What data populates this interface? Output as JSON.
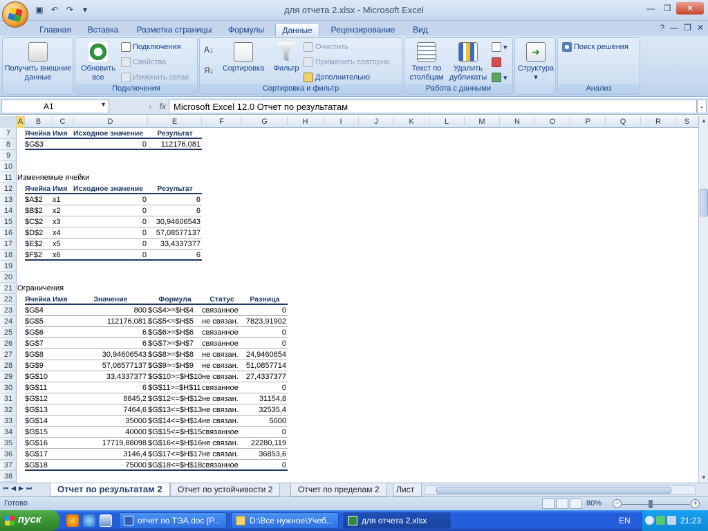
{
  "window": {
    "title": "для отчета 2.xlsx - Microsoft Excel",
    "qat": [
      "save-icon",
      "undo-icon",
      "redo-icon",
      "customize-icon"
    ]
  },
  "tabs": [
    "Главная",
    "Вставка",
    "Разметка страницы",
    "Формулы",
    "Данные",
    "Рецензирование",
    "Вид"
  ],
  "active_tab": "Данные",
  "ribbon": {
    "get_external": "Получить внешние данные",
    "refresh_all": "Обновить все",
    "connections": "Подключения",
    "properties": "Свойства",
    "edit_links": "Изменить связи",
    "group_connections": "Подключения",
    "sort": "Сортировка",
    "filter": "Фильтр",
    "clear": "Очистить",
    "reapply": "Применить повторно",
    "advanced": "Дополнительно",
    "group_sort": "Сортировка и фильтр",
    "text_to_columns": "Текст по столбцам",
    "remove_duplicates": "Удалить дубликаты",
    "group_data_tools": "Работа с данными",
    "outline": "Структура",
    "solver": "Поиск решения",
    "group_analysis": "Анализ"
  },
  "formula_bar": {
    "name_box": "A1",
    "fx": "fx",
    "content": "Microsoft Excel 12.0 Отчет по результатам"
  },
  "columns": [
    "A",
    "B",
    "C",
    "D",
    "E",
    "F",
    "G",
    "H",
    "I",
    "J",
    "K",
    "L",
    "M",
    "N",
    "O",
    "P",
    "Q",
    "R",
    "S"
  ],
  "rows": [
    "7",
    "8",
    "9",
    "10",
    "11",
    "12",
    "13",
    "14",
    "15",
    "16",
    "17",
    "18",
    "19",
    "20",
    "21",
    "22",
    "23",
    "24",
    "25",
    "26",
    "27",
    "28",
    "29",
    "30",
    "31",
    "32",
    "33",
    "34",
    "35",
    "36",
    "37",
    "38"
  ],
  "target": {
    "headers": [
      "Ячейка",
      "Имя",
      "Исходное значение",
      "Результат"
    ],
    "row": {
      "cell": "$G$3",
      "name": "",
      "initial": "0",
      "result": "112176,081"
    }
  },
  "changing": {
    "title": "Изменяемые ячейки",
    "headers": [
      "Ячейка",
      "Имя",
      "Исходное значение",
      "Результат"
    ],
    "rows": [
      {
        "cell": "$A$2",
        "name": "x1",
        "initial": "0",
        "result": "6"
      },
      {
        "cell": "$B$2",
        "name": "x2",
        "initial": "0",
        "result": "6"
      },
      {
        "cell": "$C$2",
        "name": "x3",
        "initial": "0",
        "result": "30,94606543"
      },
      {
        "cell": "$D$2",
        "name": "x4",
        "initial": "0",
        "result": "57,08577137"
      },
      {
        "cell": "$E$2",
        "name": "x5",
        "initial": "0",
        "result": "33,4337377"
      },
      {
        "cell": "$F$2",
        "name": "x6",
        "initial": "0",
        "result": "6"
      }
    ]
  },
  "constraints": {
    "title": "Ограничения",
    "headers": [
      "Ячейка",
      "Имя",
      "Значение",
      "Формула",
      "Статус",
      "Разница"
    ],
    "rows": [
      {
        "cell": "$G$4",
        "value": "800",
        "formula": "$G$4>=$H$4",
        "status": "связанное",
        "slack": "0"
      },
      {
        "cell": "$G$5",
        "value": "112176,081",
        "formula": "$G$5<=$H$5",
        "status": "не связан.",
        "slack": "7823,91902"
      },
      {
        "cell": "$G$6",
        "value": "6",
        "formula": "$G$6>=$H$6",
        "status": "связанное",
        "slack": "0"
      },
      {
        "cell": "$G$7",
        "value": "6",
        "formula": "$G$7>=$H$7",
        "status": "связанное",
        "slack": "0"
      },
      {
        "cell": "$G$8",
        "value": "30,94606543",
        "formula": "$G$8>=$H$8",
        "status": "не связан.",
        "slack": "24,9460654"
      },
      {
        "cell": "$G$9",
        "value": "57,08577137",
        "formula": "$G$9>=$H$9",
        "status": "не связан.",
        "slack": "51,0857714"
      },
      {
        "cell": "$G$10",
        "value": "33,4337377",
        "formula": "$G$10>=$H$10",
        "status": "не связан.",
        "slack": "27,4337377"
      },
      {
        "cell": "$G$11",
        "value": "6",
        "formula": "$G$11>=$H$11",
        "status": "связанное",
        "slack": "0"
      },
      {
        "cell": "$G$12",
        "value": "8845,2",
        "formula": "$G$12<=$H$12",
        "status": "не связан.",
        "slack": "31154,8"
      },
      {
        "cell": "$G$13",
        "value": "7464,6",
        "formula": "$G$13<=$H$13",
        "status": "не связан.",
        "slack": "32535,4"
      },
      {
        "cell": "$G$14",
        "value": "35000",
        "formula": "$G$14<=$H$14",
        "status": "не связан.",
        "slack": "5000"
      },
      {
        "cell": "$G$15",
        "value": "40000",
        "formula": "$G$15<=$H$15",
        "status": "связанное",
        "slack": "0"
      },
      {
        "cell": "$G$16",
        "value": "17719,88098",
        "formula": "$G$16<=$H$16",
        "status": "не связан.",
        "slack": "22280,119"
      },
      {
        "cell": "$G$17",
        "value": "3146,4",
        "formula": "$G$17<=$H$17",
        "status": "не связан.",
        "slack": "36853,6"
      },
      {
        "cell": "$G$18",
        "value": "75000",
        "formula": "$G$18<=$H$18",
        "status": "связанное",
        "slack": "0"
      }
    ]
  },
  "sheets": [
    "Отчет по результатам 2",
    "Отчет по устойчивости 2",
    "Отчет по пределам 2",
    "Лист"
  ],
  "status": {
    "ready": "Готово",
    "zoom": "80%"
  },
  "taskbar": {
    "start": "пуск",
    "buttons": [
      "отчет по ТЭА.doc [Р...",
      "D:\\Все нужное\\Учеб...",
      "для отчета 2.xlsx"
    ],
    "lang": "EN",
    "clock": "21:23"
  }
}
